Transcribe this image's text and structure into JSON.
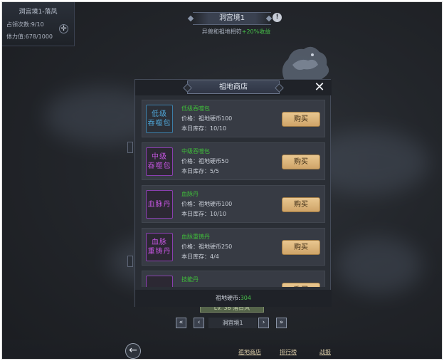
{
  "info_panel": {
    "region": "洞宫境1-落凤",
    "occupy_count": "占领次数:9/10",
    "stamina": "体力值:678/1000"
  },
  "top": {
    "title": "洞宫境1",
    "subtitle_prefix": "异兽和祖地相符",
    "subtitle_bonus": "+20%收益"
  },
  "shop": {
    "title": "祖地商店",
    "buy_label": "购买",
    "items": [
      {
        "icon_text": "低级\n吞噬包",
        "name": "低级吞噬包",
        "price": "价格：祖地硬币100",
        "stock": "本日库存：10/10",
        "icon_color": "blue"
      },
      {
        "icon_text": "中级\n吞噬包",
        "name": "中级吞噬包",
        "price": "价格：祖地硬币50",
        "stock": "本日库存：5/5",
        "icon_color": "purple"
      },
      {
        "icon_text": "血脉丹",
        "name": "血脉丹",
        "price": "价格：祖地硬币100",
        "stock": "本日库存：10/10",
        "icon_color": "purple"
      },
      {
        "icon_text": "血脉\n重铸丹",
        "name": "血脉重铸丹",
        "price": "价格：祖地硬币250",
        "stock": "本日库存：4/4",
        "icon_color": "purple"
      },
      {
        "icon_text": "",
        "name": "技能丹",
        "price": "",
        "stock": "",
        "icon_color": "purple"
      }
    ],
    "coins_label": "祖地硬币:",
    "coins_value": "304"
  },
  "level_tag": "Lv. 36  落日风",
  "pager": {
    "first": "«",
    "prev": "‹",
    "label": "洞宫境1",
    "next": "›",
    "last": "»"
  },
  "bottom": {
    "back": "←",
    "links": [
      "祖地商店",
      "排行榜",
      "战报"
    ]
  },
  "colors": {
    "accent_green": "#47c24a",
    "buy_button": "#dcb47a",
    "blue_icon": "#4fa5d6",
    "purple_icon": "#c255de"
  }
}
